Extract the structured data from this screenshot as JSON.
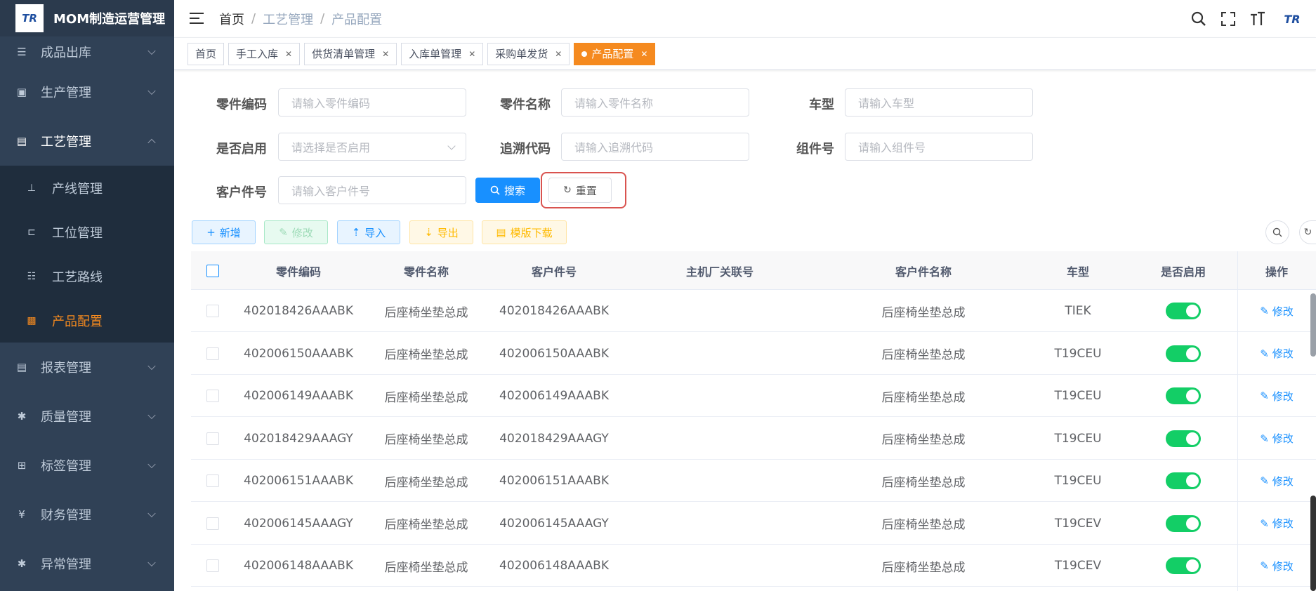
{
  "app": {
    "logo_text": "TR",
    "title": "MOM制造运营管理"
  },
  "sidebar": {
    "items": [
      {
        "label": "成品出库",
        "icon": "list-icon"
      },
      {
        "label": "生产管理",
        "icon": "production-icon"
      },
      {
        "label": "工艺管理",
        "icon": "process-icon",
        "expanded": true
      },
      {
        "label": "报表管理",
        "icon": "report-icon"
      },
      {
        "label": "质量管理",
        "icon": "bug-icon"
      },
      {
        "label": "标签管理",
        "icon": "grid-icon"
      },
      {
        "label": "财务管理",
        "icon": "yen-icon"
      },
      {
        "label": "异常管理",
        "icon": "bug-icon"
      }
    ],
    "submenu": [
      {
        "label": "产线管理",
        "icon": "tree-icon"
      },
      {
        "label": "工位管理",
        "icon": "station-icon"
      },
      {
        "label": "工艺路线",
        "icon": "route-icon"
      },
      {
        "label": "产品配置",
        "icon": "product-icon",
        "active": true
      }
    ]
  },
  "header": {
    "breadcrumb": [
      "首页",
      "工艺管理",
      "产品配置"
    ]
  },
  "tags": [
    {
      "label": "首页",
      "closable": false
    },
    {
      "label": "手工入库",
      "closable": true
    },
    {
      "label": "供货清单管理",
      "closable": true
    },
    {
      "label": "入库单管理",
      "closable": true
    },
    {
      "label": "采购单发货",
      "closable": true
    },
    {
      "label": "产品配置",
      "closable": true,
      "active": true
    }
  ],
  "form": {
    "part_code": {
      "label": "零件编码",
      "placeholder": "请输入零件编码"
    },
    "part_name": {
      "label": "零件名称",
      "placeholder": "请输入零件名称"
    },
    "vehicle": {
      "label": "车型",
      "placeholder": "请输入车型"
    },
    "enabled": {
      "label": "是否启用",
      "placeholder": "请选择是否启用"
    },
    "trace_code": {
      "label": "追溯代码",
      "placeholder": "请输入追溯代码"
    },
    "component": {
      "label": "组件号",
      "placeholder": "请输入组件号"
    },
    "customer_part": {
      "label": "客户件号",
      "placeholder": "请输入客户件号"
    },
    "search_label": "搜索",
    "reset_label": "重置"
  },
  "toolbar": {
    "add": "新增",
    "edit": "修改",
    "import": "导入",
    "export": "导出",
    "template": "模版下载"
  },
  "table": {
    "columns": [
      "零件编码",
      "零件名称",
      "客户件号",
      "主机厂关联号",
      "客户件名称",
      "车型",
      "是否启用",
      "操作"
    ],
    "edit_label": "修改",
    "rows": [
      {
        "code": "402018426AAABK",
        "name": "后座椅坐垫总成",
        "customer_part": "402018426AAABK",
        "oem_ref": "",
        "customer_name": "后座椅坐垫总成",
        "vehicle": "TIEK",
        "enabled": true
      },
      {
        "code": "402006150AAABK",
        "name": "后座椅坐垫总成",
        "customer_part": "402006150AAABK",
        "oem_ref": "",
        "customer_name": "后座椅坐垫总成",
        "vehicle": "T19CEU",
        "enabled": true
      },
      {
        "code": "402006149AAABK",
        "name": "后座椅坐垫总成",
        "customer_part": "402006149AAABK",
        "oem_ref": "",
        "customer_name": "后座椅坐垫总成",
        "vehicle": "T19CEU",
        "enabled": true
      },
      {
        "code": "402018429AAAGY",
        "name": "后座椅坐垫总成",
        "customer_part": "402018429AAAGY",
        "oem_ref": "",
        "customer_name": "后座椅坐垫总成",
        "vehicle": "T19CEU",
        "enabled": true
      },
      {
        "code": "402006151AAABK",
        "name": "后座椅坐垫总成",
        "customer_part": "402006151AAABK",
        "oem_ref": "",
        "customer_name": "后座椅坐垫总成",
        "vehicle": "T19CEU",
        "enabled": true
      },
      {
        "code": "402006145AAAGY",
        "name": "后座椅坐垫总成",
        "customer_part": "402006145AAAGY",
        "oem_ref": "",
        "customer_name": "后座椅坐垫总成",
        "vehicle": "T19CEV",
        "enabled": true
      },
      {
        "code": "402006148AAABK",
        "name": "后座椅坐垫总成",
        "customer_part": "402006148AAABK",
        "oem_ref": "",
        "customer_name": "后座椅坐垫总成",
        "vehicle": "T19CEV",
        "enabled": true
      }
    ]
  },
  "colors": {
    "sidebar_bg": "#304156",
    "accent": "#f58a1f",
    "primary": "#1890ff",
    "switch_on": "#13ce66"
  }
}
